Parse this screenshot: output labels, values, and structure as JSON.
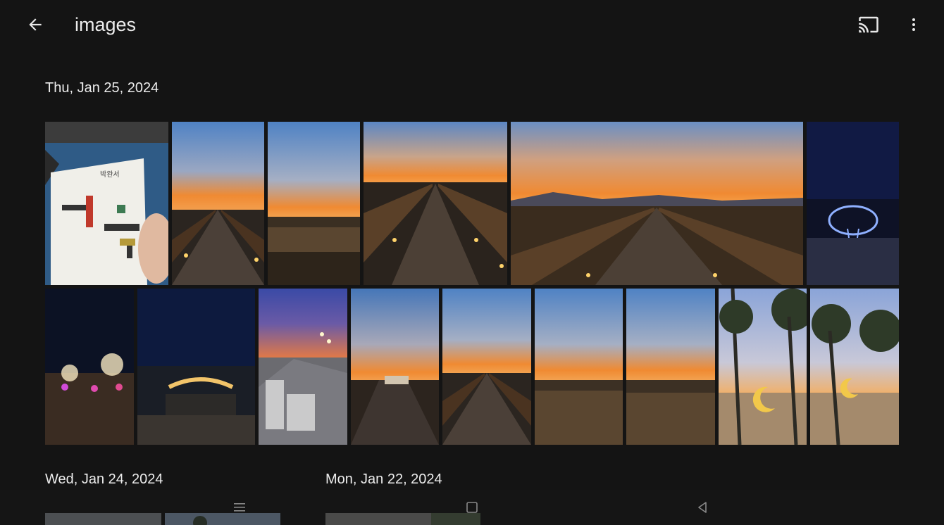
{
  "app_bar": {
    "title": "images",
    "back_icon": "arrow-left-icon",
    "cast_icon": "cast-icon",
    "more_icon": "more-vert-icon"
  },
  "sections": [
    {
      "date": "Thu, Jan 25, 2024"
    },
    {
      "date": "Wed, Jan 24, 2024"
    },
    {
      "date": "Mon, Jan 22, 2024"
    }
  ],
  "photos": [
    {
      "subject": "book-cover"
    },
    {
      "subject": "boardwalk-sunset"
    },
    {
      "subject": "reeds-sunset"
    },
    {
      "subject": "boardwalk-sunset"
    },
    {
      "subject": "boardwalk-sunset"
    },
    {
      "subject": "whale-light-sculpture"
    },
    {
      "subject": "night-lights-park"
    },
    {
      "subject": "night-bridge"
    },
    {
      "subject": "street-dusk"
    },
    {
      "subject": "boardwalk-dusk"
    },
    {
      "subject": "boardwalk-sunset"
    },
    {
      "subject": "reeds-sunset"
    },
    {
      "subject": "reeds-sunset"
    },
    {
      "subject": "moon-sculpture-pines"
    },
    {
      "subject": "moon-sculpture-pines"
    },
    {
      "subject": "gray-sky"
    },
    {
      "subject": "pine-sky"
    },
    {
      "subject": "indoor-cup"
    }
  ],
  "system_nav": {
    "recents_icon": "recents-icon",
    "home_icon": "home-icon",
    "back_icon": "system-back-icon"
  },
  "colors": {
    "background": "#141414",
    "sky_top": "#5b86c4",
    "sunset_orange": "#f08a32",
    "boardwalk_wood": "#5a4028"
  }
}
